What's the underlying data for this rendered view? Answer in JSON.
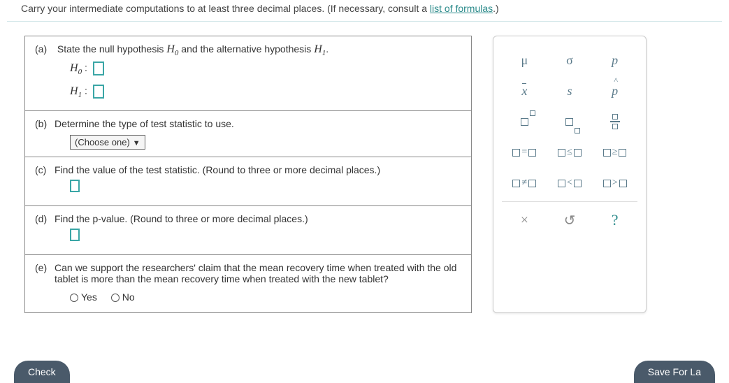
{
  "instruction": {
    "text": "Carry your intermediate computations to at least three decimal places. (If necessary, consult a ",
    "link_text": "list of formulas",
    "suffix": ".)"
  },
  "parts": {
    "a": {
      "label": "(a)",
      "text": "State the null hypothesis ",
      "h0": "H",
      "h0_sub": "0",
      "mid": " and the alternative hypothesis ",
      "h1": "H",
      "h1_sub": "1",
      "end": ".",
      "h0_label": "H",
      "h0_label_sub": "0",
      "h1_label": "H",
      "h1_label_sub": "1",
      "colon": " :"
    },
    "b": {
      "label": "(b)",
      "text": "Determine the type of test statistic to use.",
      "select": "(Choose one)"
    },
    "c": {
      "label": "(c)",
      "text": "Find the value of the test statistic. (Round to three or more decimal places.)"
    },
    "d": {
      "label": "(d)",
      "text": "Find the p-value. (Round to three or more decimal places.)"
    },
    "e": {
      "label": "(e)",
      "text": "Can we support the researchers' claim that the mean recovery time when treated with the old tablet is more than the mean recovery time when treated with the new tablet?",
      "yes": "Yes",
      "no": "No"
    }
  },
  "palette": {
    "mu": "μ",
    "sigma": "σ",
    "p": "p",
    "xbar": "x",
    "s": "s",
    "phat": "p",
    "eq": "=",
    "le": "≤",
    "ge": "≥",
    "ne": "≠",
    "lt": "<",
    "gt": ">",
    "times": "×",
    "reset": "↺",
    "help": "?"
  },
  "footer": {
    "check": "Check",
    "save": "Save For La"
  }
}
